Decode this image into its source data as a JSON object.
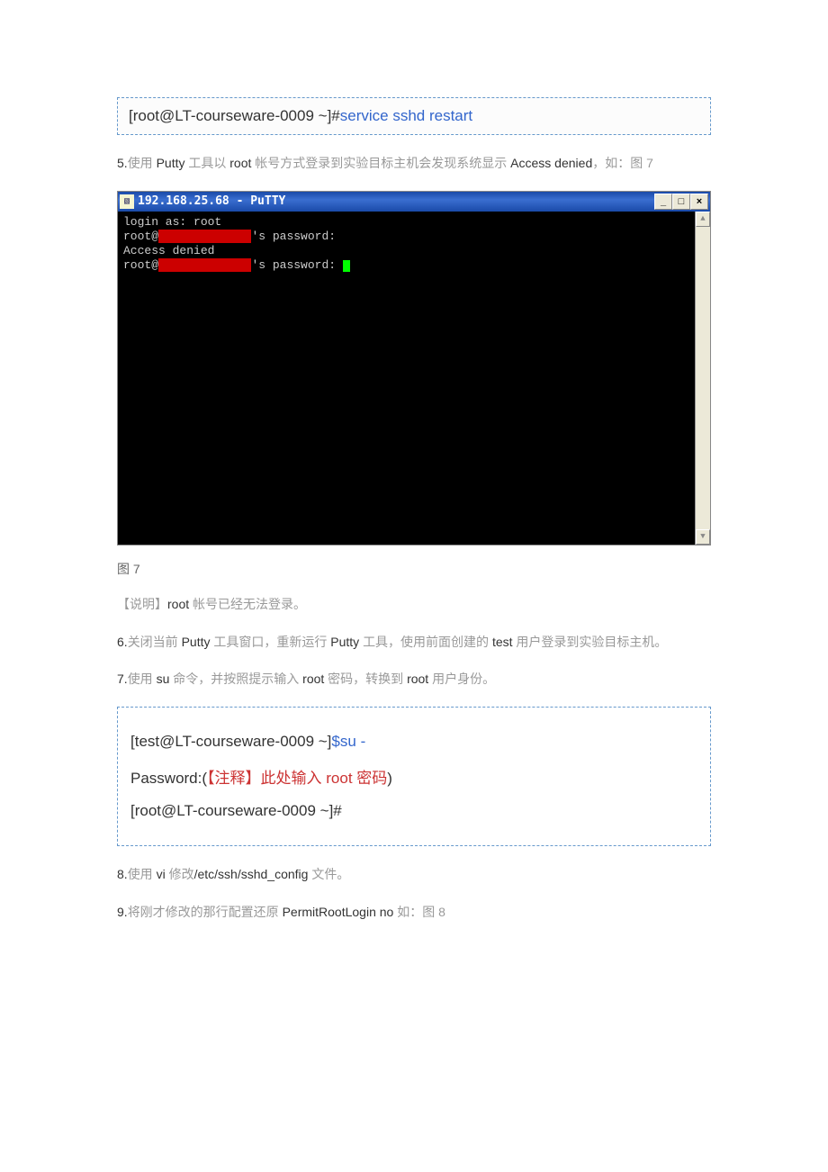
{
  "command1": {
    "prompt": "[root@LT-courseware-0009 ~]#",
    "cmd": "service sshd restart"
  },
  "step5": {
    "num": "5.",
    "text_cn1": "使用 ",
    "text_en1": "Putty ",
    "text_cn2": "工具以 ",
    "text_en2": "root ",
    "text_cn3": "帐号方式登录到实验目标主机会发现系统显示 ",
    "text_en3": "Access denied",
    "text_cn4": "，如：图 7"
  },
  "putty": {
    "title": "192.168.25.68 - PuTTY",
    "min": "_",
    "max": "□",
    "close": "×",
    "line1": "login as: root",
    "line2a": "root@",
    "line2b": "'s password:",
    "line3": "Access denied",
    "line4a": "root@",
    "line4b": "'s password: ",
    "redacted": "192.168.25.68",
    "scroll_up": "▲",
    "scroll_down": "▼"
  },
  "fig7": "图 7",
  "note1": {
    "prefix": "【说明】",
    "text_en": "root ",
    "text_cn": "帐号已经无法登录。"
  },
  "step6": {
    "num": "6.",
    "text_cn1": "关闭当前 ",
    "text_en1": "Putty ",
    "text_cn2": "工具窗口，重新运行 ",
    "text_en2": "Putty ",
    "text_cn3": "工具，使用前面创建的 ",
    "text_en3": "test ",
    "text_cn4": "用户登录到实验目标主机。"
  },
  "step7": {
    "num": "7.",
    "text_cn1": "使用 ",
    "text_en1": "su ",
    "text_cn2": "命令，并按照提示输入 ",
    "text_en2": "root ",
    "text_cn3": "密码，转换到 ",
    "text_en3": "root ",
    "text_cn4": "用户身份。"
  },
  "block2": {
    "row1_prompt": "[test@LT-courseware-0009 ~]",
    "row1_dollar": "$",
    "row1_cmd": "su -",
    "row2_prefix": "Password:(",
    "row2_note": "【注释】此处输入 root 密码",
    "row2_suffix": ")",
    "row3": "[root@LT-courseware-0009 ~]#"
  },
  "step8": {
    "num": "8.",
    "text_cn1": "使用 ",
    "text_en1": "vi ",
    "text_cn2": "修改",
    "text_en2": "/etc/ssh/sshd_config ",
    "text_cn3": "文件。"
  },
  "step9": {
    "num": "9.",
    "text_cn1": "将刚才修改的那行配置还原 ",
    "text_red": "PermitRootLogin no ",
    "text_cn2": "如：图 8"
  }
}
